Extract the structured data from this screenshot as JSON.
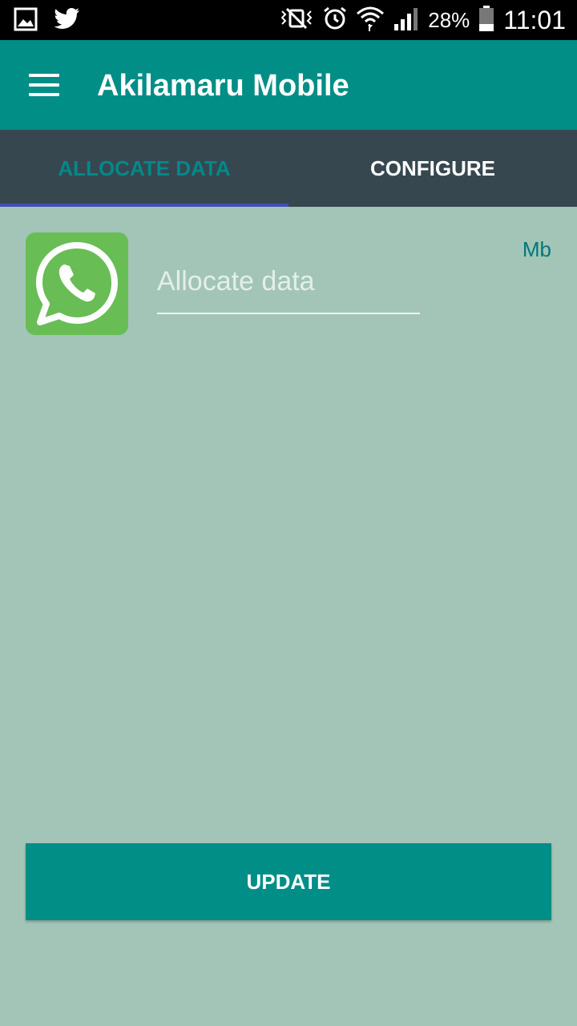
{
  "status_bar": {
    "battery": "28%",
    "time": "11:01",
    "icons": [
      "gallery-icon",
      "twitter-icon",
      "mute-icon",
      "alarm-icon",
      "wifi-icon",
      "signal-icon",
      "battery-icon"
    ]
  },
  "app_bar": {
    "title": "Akilamaru Mobile",
    "menu_icon": "hamburger-menu-icon"
  },
  "tabs": [
    {
      "label": "ALLOCATE DATA",
      "selected": true
    },
    {
      "label": "CONFIGURE",
      "selected": false
    }
  ],
  "allocation": {
    "app_icon": "whatsapp-icon",
    "input_placeholder": "Allocate data",
    "input_value": "",
    "unit": "Mb"
  },
  "update_button": {
    "label": "UPDATE"
  },
  "colors": {
    "primary": "#008e87",
    "tab_bar": "#37474f",
    "tab_indicator": "#3f51b5",
    "background": "#a3c5b7",
    "whatsapp_green": "#68bd55"
  }
}
